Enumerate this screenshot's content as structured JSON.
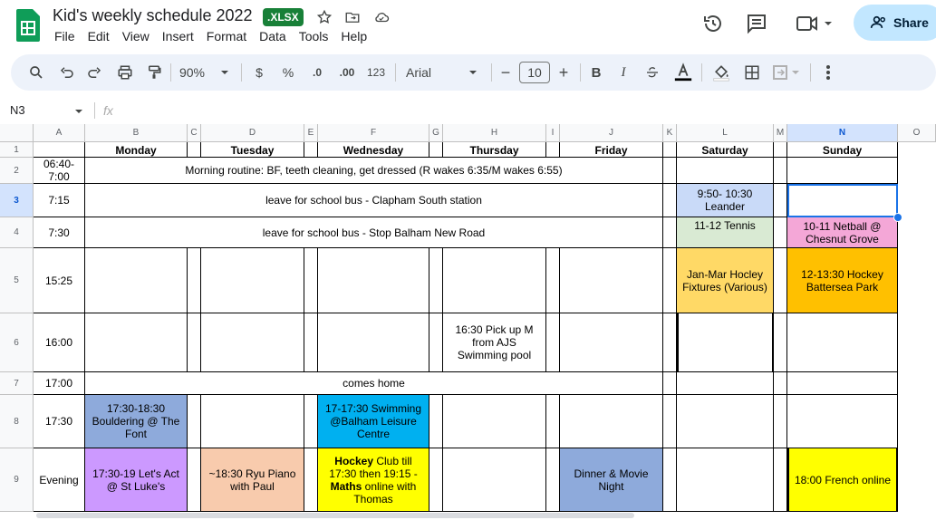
{
  "app": {
    "title": "Kid's weekly schedule 2022",
    "badge": "XLSX",
    "badge_label": ".XLSX",
    "menu": [
      "File",
      "Edit",
      "View",
      "Insert",
      "Format",
      "Data",
      "Tools",
      "Help"
    ],
    "share_label": "Share"
  },
  "toolbar": {
    "zoom": "90%",
    "currency": "$",
    "percent": "%",
    "dec_decrease": ".0",
    "dec_increase": ".00",
    "number_format": "123",
    "font": "Arial",
    "font_size": "10",
    "bold": "B",
    "italic": "I"
  },
  "formula_bar": {
    "name_box": "N3",
    "fx": "fx"
  },
  "columns": [
    "A",
    "B",
    "C",
    "D",
    "E",
    "F",
    "G",
    "H",
    "I",
    "J",
    "K",
    "L",
    "M",
    "N",
    "O"
  ],
  "rows": [
    "1",
    "2",
    "3",
    "4",
    "5",
    "6",
    "7",
    "8",
    "9"
  ],
  "days": {
    "monday": "Monday",
    "tuesday": "Tuesday",
    "wednesday": "Wednesday",
    "thursday": "Thursday",
    "friday": "Friday",
    "saturday": "Saturday",
    "sunday": "Sunday"
  },
  "times": {
    "r2": "06:40-7:00",
    "r3": "7:15",
    "r4": "7:30",
    "r5": "15:25",
    "r6": "16:00",
    "r7": "17:00",
    "r8": "17:30",
    "r9": "Evening"
  },
  "events": {
    "morning_routine": "Morning routine: BF, teeth cleaning, get dressed (R wakes 6:35/M wakes 6:55)",
    "school_bus_clapham": "leave for school bus - Clapham South station",
    "school_bus_balham": "leave for school bus - Stop Balham New Road",
    "sat_leander": "9:50- 10:30 Leander",
    "sat_tennis": "11-12 Tennis",
    "sun_netball": "10-11  Netball @ Chesnut Grove",
    "sat_hockey": "Jan-Mar Hocley Fixtures (Various)",
    "sun_hockey": "12-13:30 Hockey Battersea Park",
    "thu_pickup": "16:30 Pick up M from AJS Swimming pool",
    "comes_home": "comes home",
    "mon_bouldering": "17:30-18:30 Bouldering @ The Font",
    "wed_swimming": "17-17:30 Swimming @Balham Leisure Centre",
    "mon_lets_act": "17:30-19 Let's Act @ St Luke's",
    "tue_piano": "~18:30 Ryu Piano with Paul",
    "wed_hockey_1": "Hockey",
    "wed_hockey_2": " Club till 17:30 then 19:15 - ",
    "wed_hockey_3": "Maths",
    "wed_hockey_4": " online with Thomas",
    "fri_dinner": "Dinner & Movie Night",
    "sun_french": "18:00 French online"
  },
  "colors": {
    "blue_light": "#c9daf8",
    "green_light": "#d9ead3",
    "pink": "#f4a7d7",
    "yellow_orange": "#ffd966",
    "amber": "#ffc000",
    "slate_blue": "#8eaadb",
    "cyan": "#00b0f0",
    "lavender": "#cc99ff",
    "peach": "#f8cbad",
    "yellow": "#ffff00",
    "accent": "#1a73e8"
  }
}
